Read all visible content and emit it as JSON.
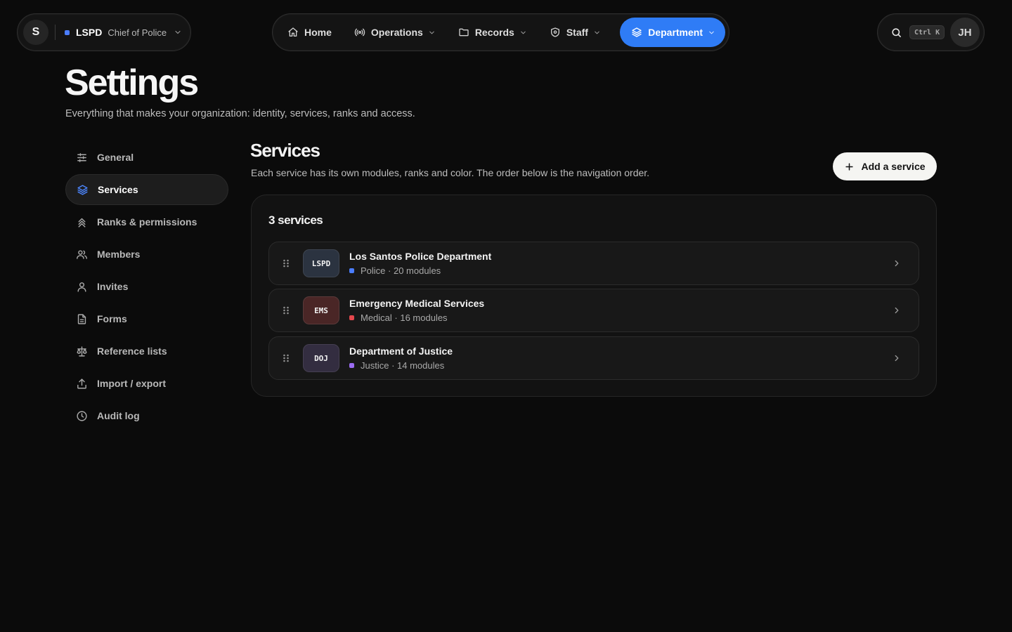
{
  "org": {
    "avatar_initial": "S",
    "name": "LSPD",
    "role": "Chief of Police",
    "accent": "#4a7dff"
  },
  "nav": {
    "items": [
      {
        "label": "Home",
        "icon": "home-icon"
      },
      {
        "label": "Operations",
        "icon": "radio-icon"
      },
      {
        "label": "Records",
        "icon": "folder-icon"
      },
      {
        "label": "Staff",
        "icon": "shield-icon"
      },
      {
        "label": "Department",
        "icon": "layers-icon",
        "active": true
      }
    ],
    "active_color": "#2f7cf6"
  },
  "topbar": {
    "shortcut": "Ctrl K",
    "user_initials": "JH"
  },
  "page": {
    "title": "Settings",
    "subtitle": "Everything that makes your organization: identity, services, ranks and access."
  },
  "settings_nav": {
    "items": [
      {
        "label": "General",
        "icon": "sliders-icon"
      },
      {
        "label": "Services",
        "icon": "layers-icon",
        "active": true
      },
      {
        "label": "Ranks & permissions",
        "icon": "chevrons-up-icon"
      },
      {
        "label": "Members",
        "icon": "users-icon"
      },
      {
        "label": "Invites",
        "icon": "user-icon"
      },
      {
        "label": "Forms",
        "icon": "file-icon"
      },
      {
        "label": "Reference lists",
        "icon": "scale-icon"
      },
      {
        "label": "Import / export",
        "icon": "upload-icon"
      },
      {
        "label": "Audit log",
        "icon": "clock-icon"
      }
    ]
  },
  "section": {
    "title": "Services",
    "description": "Each service has its own modules, ranks and color. The order below is the navigation order.",
    "add_button": "Add a service"
  },
  "services": {
    "count_label": "3 services",
    "items": [
      {
        "code": "LSPD",
        "name": "Los Santos Police Department",
        "meta": "Police · 20 modules",
        "color": "#4a7dff",
        "badge_bg": "#2b3340"
      },
      {
        "code": "EMS",
        "name": "Emergency Medical Services",
        "meta": "Medical · 16 modules",
        "color": "#e5484d",
        "badge_bg": "#4a2626"
      },
      {
        "code": "DOJ",
        "name": "Department of Justice",
        "meta": "Justice · 14 modules",
        "color": "#9b6cf2",
        "badge_bg": "#332d40"
      }
    ]
  }
}
